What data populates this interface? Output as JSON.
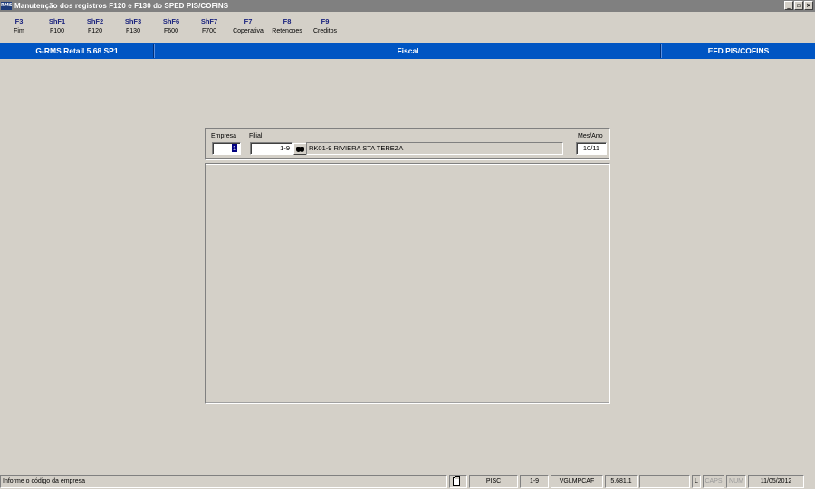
{
  "window": {
    "app_icon": "RMS",
    "title": "Manutenção dos registros F120 e F130 do SPED PIS/COFINS",
    "buttons": {
      "minimize": "_",
      "restore": "▫",
      "close": "×"
    }
  },
  "function_keys": [
    {
      "key": "F3",
      "label": "Fim"
    },
    {
      "key": "ShF1",
      "label": "F100"
    },
    {
      "key": "ShF2",
      "label": "F120"
    },
    {
      "key": "ShF3",
      "label": "F130"
    },
    {
      "key": "ShF6",
      "label": "F600"
    },
    {
      "key": "ShF7",
      "label": "F700"
    },
    {
      "key": "F7",
      "label": "Coperativa"
    },
    {
      "key": "F8",
      "label": "Retencoes"
    },
    {
      "key": "F9",
      "label": "Creditos"
    }
  ],
  "header": {
    "product": "G-RMS Retail 5.68 SP1",
    "module": "Fiscal",
    "area": "EFD PIS/COFINS"
  },
  "form": {
    "empresa_label": "Empresa",
    "empresa_value": "1",
    "filial_label": "Filial",
    "filial_value": "1-9",
    "filial_description": "RK01-9 RIVIERA STA TEREZA",
    "mesano_label": "Mes/Ano",
    "mesano_value": "10/11"
  },
  "statusbar": {
    "message": "Informe o código da empresa",
    "program": "PISC",
    "filial": "1-9",
    "user": "VGLMPCAF",
    "version": "5.681.1",
    "mode": "L",
    "caps": "CAPS",
    "num": "NUM",
    "date": "11/05/2012"
  },
  "icons": {
    "search": "binoculars-icon",
    "clipboard": "clipboard-icon"
  }
}
